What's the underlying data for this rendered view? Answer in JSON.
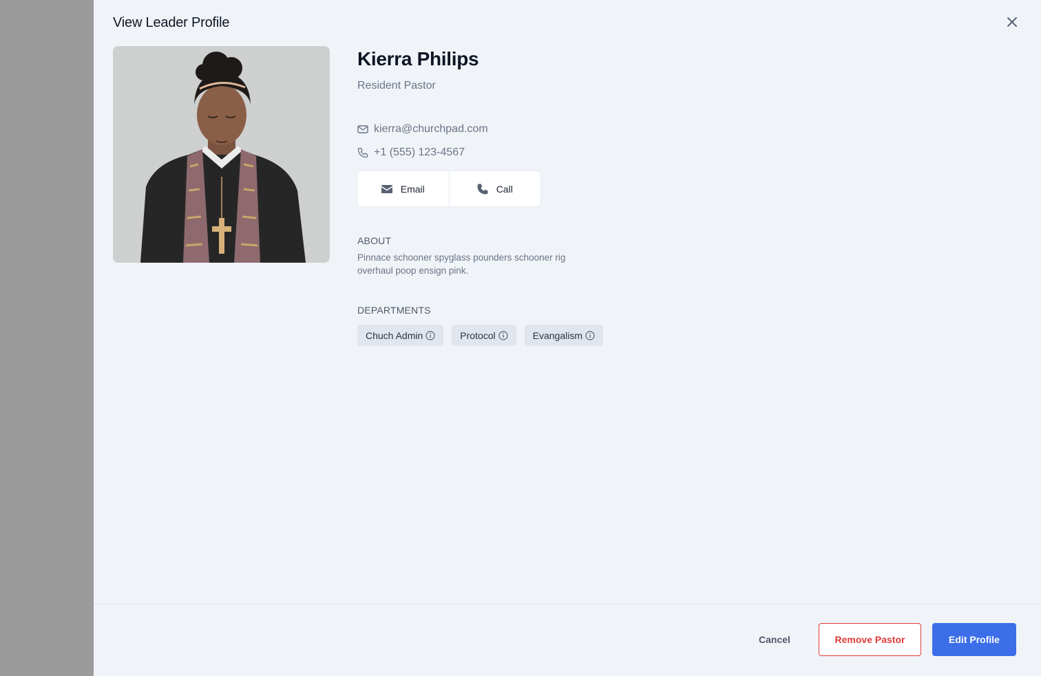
{
  "panel": {
    "title": "View Leader Profile"
  },
  "profile": {
    "name": "Kierra Philips",
    "role": "Resident Pastor",
    "email": "kierra@churchpad.com",
    "phone": "+1 (555) 123-4567"
  },
  "actions": {
    "email_label": "Email",
    "call_label": "Call"
  },
  "about": {
    "heading": "ABOUT",
    "text": "Pinnace schooner spyglass pounders schooner rig overhaul poop ensign pink."
  },
  "departments": {
    "heading": "DEPARTMENTS",
    "items": [
      {
        "label": "Chuch Admin"
      },
      {
        "label": "Protocol"
      },
      {
        "label": "Evangalism"
      }
    ]
  },
  "footer": {
    "cancel_label": "Cancel",
    "remove_label": "Remove Pastor",
    "edit_label": "Edit Profile"
  },
  "colors": {
    "accent": "#3b6ee8",
    "danger": "#e03a3a",
    "panel_bg": "#f0f4f9",
    "overlay": "#9b9b9b"
  },
  "icons": {
    "close": "close-icon",
    "email": "mail-icon",
    "phone": "phone-icon",
    "info": "info-icon"
  }
}
